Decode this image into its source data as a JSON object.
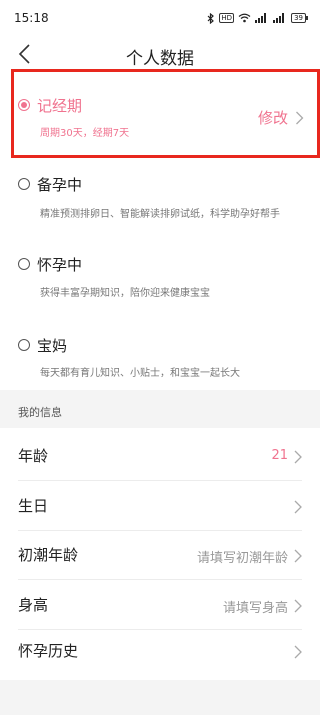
{
  "status_bar": {
    "time": "15:18",
    "hd_badge": "HD",
    "battery": "39"
  },
  "nav": {
    "title": "个人数据"
  },
  "stages": [
    {
      "label": "记经期",
      "desc": "周期30天，经期7天",
      "action": "修改",
      "selected": true
    },
    {
      "label": "备孕中",
      "desc": "精准预测排卵日、智能解读排卵试纸，科学助孕好帮手",
      "selected": false
    },
    {
      "label": "怀孕中",
      "desc": "获得丰富孕期知识，陪你迎来健康宝宝",
      "selected": false
    },
    {
      "label": "宝妈",
      "desc": "每天都有育儿知识、小贴士，和宝宝一起长大",
      "selected": false
    }
  ],
  "info_section": {
    "title": "我的信息"
  },
  "info_rows": [
    {
      "label": "年龄",
      "value": "21"
    },
    {
      "label": "生日",
      "value": ""
    },
    {
      "label": "初潮年龄",
      "value": "请填写初潮年龄"
    },
    {
      "label": "身高",
      "value": "请填写身高"
    },
    {
      "label": "怀孕历史",
      "value": ""
    }
  ],
  "colors": {
    "accent": "#f0738f",
    "highlight_border": "#e8281e",
    "background": "#f4f4f4"
  },
  "icons": [
    "back-arrow-icon",
    "chevron-right-icon",
    "radio-icon",
    "bluetooth-icon",
    "wifi-icon",
    "signal-icon",
    "battery-icon"
  ]
}
